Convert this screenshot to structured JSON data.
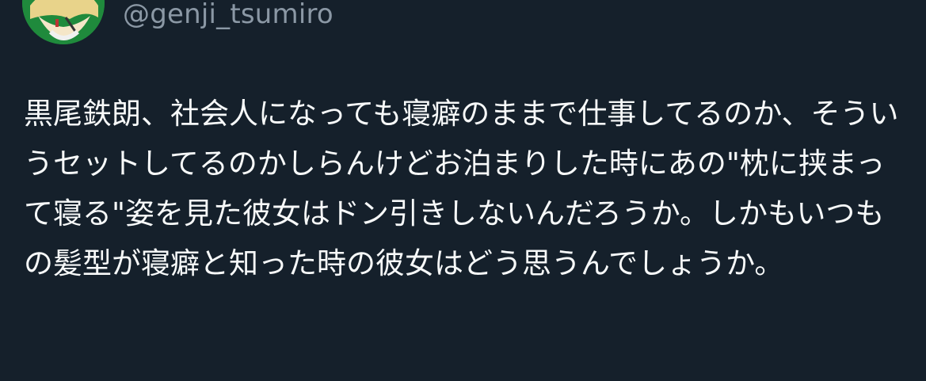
{
  "tweet": {
    "handle": "@genji_tsumiro",
    "text": "黒尾鉄朗、社会人になっても寝癖のままで仕事してるのか、そういうセットしてるのかしらんけどお泊まりした時にあの\"枕に挟まって寝る\"姿を見た彼女はドン引きしないんだろうか。しかもいつもの髪型が寝癖と知った時の彼女はどう思うんでしょうか。"
  },
  "colors": {
    "background": "#15202b",
    "text": "#f7f9f9",
    "handle": "#8b98a5",
    "avatar_bg": "#1f8a3c"
  },
  "icons": {
    "avatar": "user-avatar"
  }
}
